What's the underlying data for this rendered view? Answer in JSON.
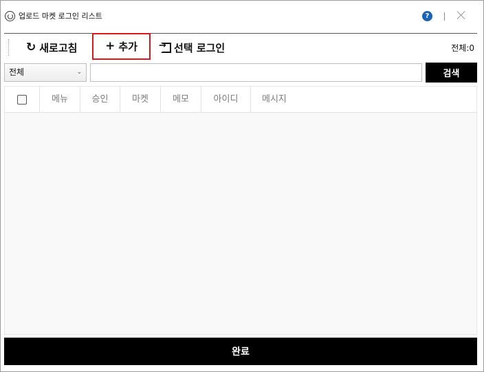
{
  "window": {
    "title": "업로드 마켓 로그인 리스트",
    "help_label": "?"
  },
  "toolbar": {
    "refresh_label": "새로고침",
    "refresh_icon": "refresh-icon",
    "add_label": "추가",
    "add_icon": "plus-icon",
    "select_login_label": "선택 로그인",
    "select_login_icon": "login-icon",
    "total_label": "전체:0",
    "highlight_color": "#e0151a"
  },
  "search": {
    "filter_selected": "전체",
    "input_value": "",
    "button_label": "검색"
  },
  "grid": {
    "columns": [
      "메뉴",
      "승인",
      "마켓",
      "메모",
      "아이디",
      "메시지"
    ],
    "rows": []
  },
  "footer": {
    "done_label": "완료"
  }
}
